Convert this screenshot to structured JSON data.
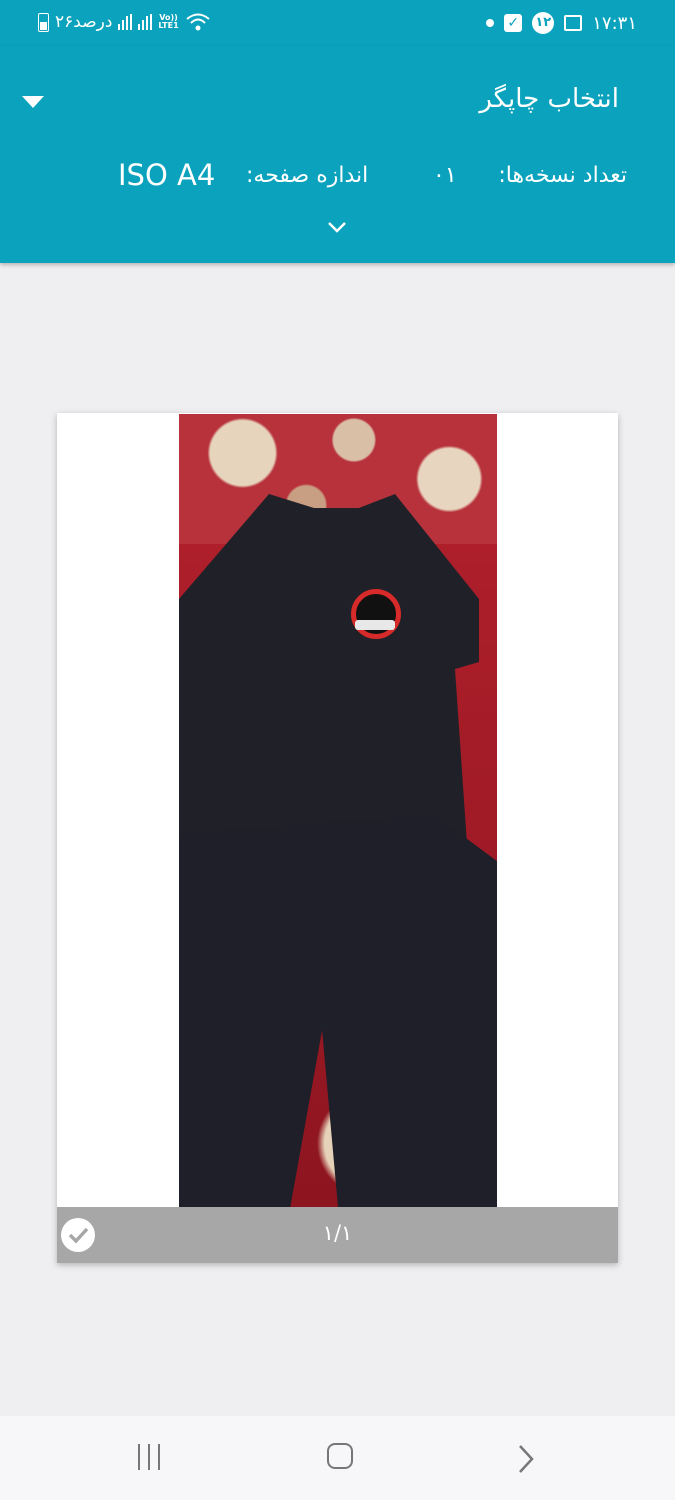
{
  "status_bar": {
    "time": "۱۷:۳۱",
    "battery": "۲۶درصد",
    "network": "LTE1",
    "volte": "Vo))",
    "notification_count": "۱۲"
  },
  "header": {
    "printer_title": "انتخاب چاپگر",
    "copies_label": "تعداد نسخه‌ها:",
    "copies_value": "۰۱",
    "size_label": "اندازه صفحه:",
    "size_value": "ISO A4"
  },
  "preview": {
    "page_number": "۱/۱"
  },
  "colors": {
    "accent": "#0aa2bc",
    "background": "#efeff1",
    "page_footer": "#a7a7a7"
  }
}
